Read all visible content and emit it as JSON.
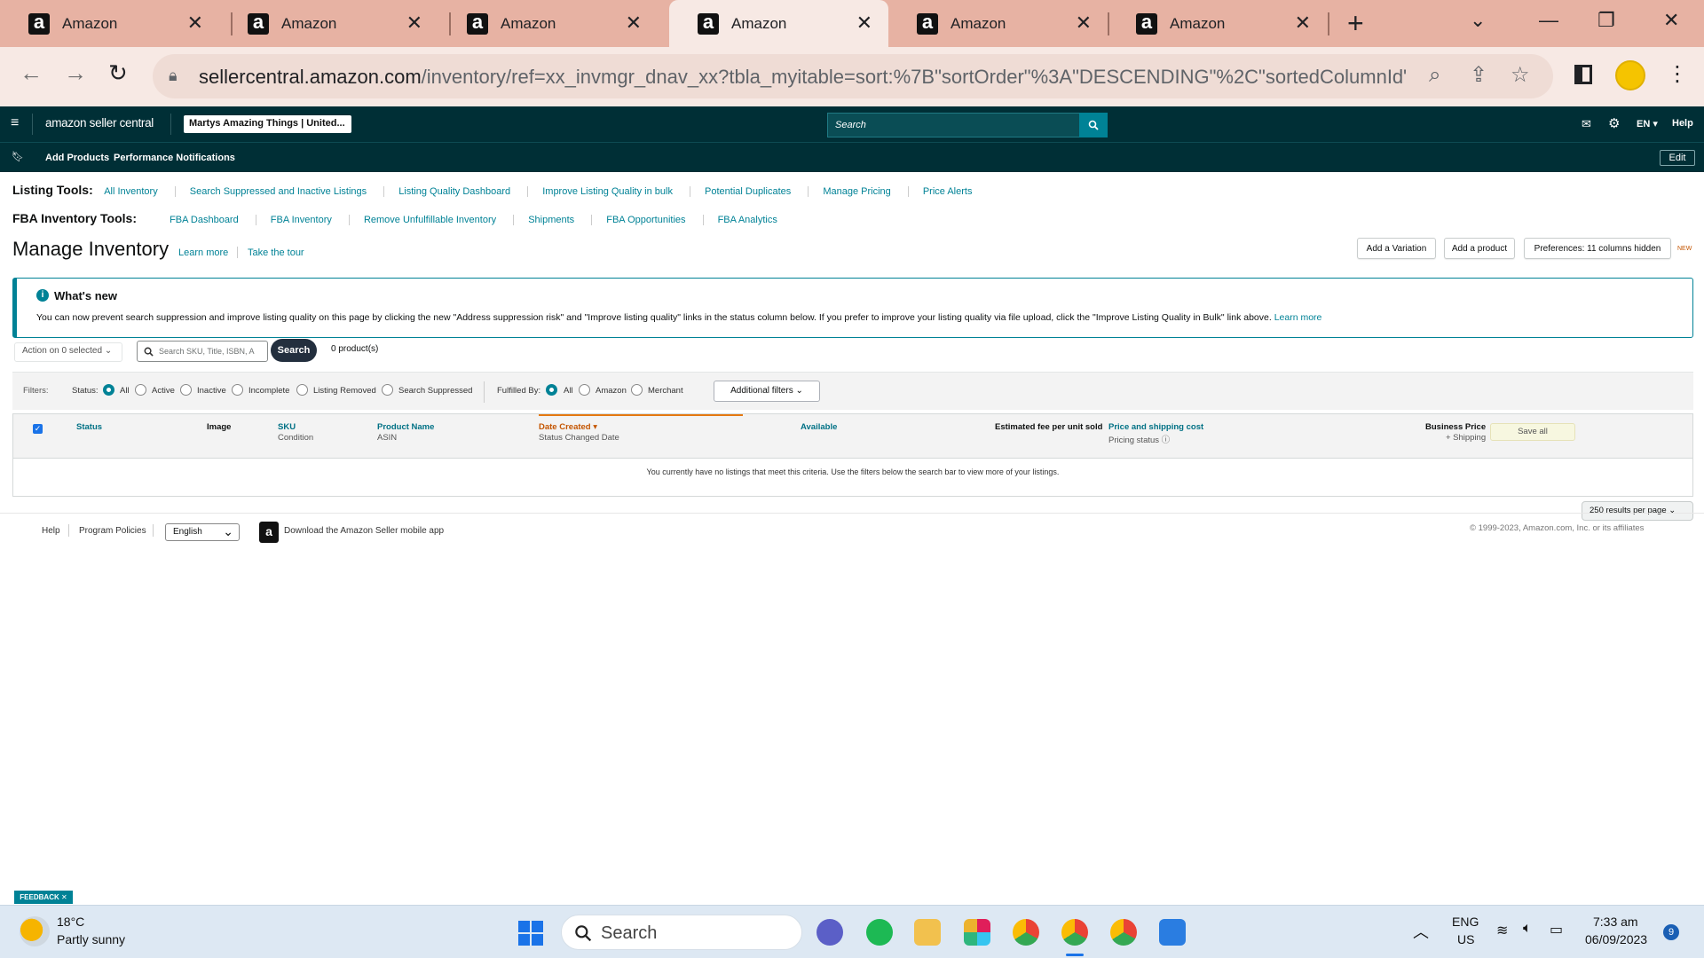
{
  "browser": {
    "tabs": [
      {
        "title": "Amazon"
      },
      {
        "title": "Amazon"
      },
      {
        "title": "Amazon"
      },
      {
        "title": "Amazon",
        "active": true
      },
      {
        "title": "Amazon"
      },
      {
        "title": "Amazon"
      }
    ],
    "url_host": "sellercentral.amazon.com",
    "url_path": "/inventory/ref=xx_invmgr_dnav_xx?tbla_myitable=sort:%7B\"sortOrder\"%3A\"DESCENDING\"%2C\"sortedColumnId\"..."
  },
  "seller_nav": {
    "brand": "amazon seller central",
    "store": "Martys Amazing Things | United...",
    "search_placeholder": "Search",
    "lang": "EN",
    "help": "Help",
    "bookmarks": [
      "Add Products",
      "Performance Notifications"
    ],
    "edit": "Edit"
  },
  "listing_tools": {
    "label": "Listing Tools:",
    "links": [
      "All Inventory",
      "Search Suppressed and Inactive Listings",
      "Listing Quality Dashboard",
      "Improve Listing Quality in bulk",
      "Potential Duplicates",
      "Manage Pricing",
      "Price Alerts"
    ]
  },
  "fba_tools": {
    "label": "FBA Inventory Tools:",
    "links": [
      "FBA Dashboard",
      "FBA Inventory",
      "Remove Unfulfillable Inventory",
      "Shipments",
      "FBA Opportunities",
      "FBA Analytics"
    ]
  },
  "page": {
    "title": "Manage Inventory",
    "learn_more": "Learn more",
    "tour": "Take the tour",
    "add_variation": "Add a Variation",
    "add_product": "Add a product",
    "preferences": "Preferences: 11 columns hidden",
    "new_badge": "NEW"
  },
  "whats_new": {
    "title": "What's new",
    "text": "You can now prevent search suppression and improve listing quality on this page by clicking the new \"Address suppression risk\" and \"Improve listing quality\" links in the status column below. If you prefer to improve your listing quality via file upload, click the \"Improve Listing Quality in Bulk\" link above.",
    "link": "Learn more"
  },
  "actions": {
    "action_dropdown": "Action on 0 selected",
    "search_placeholder": "Search SKU, Title, ISBN, A",
    "search_button": "Search",
    "product_count": "0 product(s)"
  },
  "filters": {
    "label": "Filters:",
    "status_label": "Status:",
    "status_options": [
      "All",
      "Active",
      "Inactive",
      "Incomplete",
      "Listing Removed",
      "Search Suppressed"
    ],
    "fulfilled_label": "Fulfilled By:",
    "fulfilled_options": [
      "All",
      "Amazon",
      "Merchant"
    ],
    "additional": "Additional filters"
  },
  "table": {
    "headers": {
      "status": "Status",
      "image": "Image",
      "sku": "SKU",
      "sku_sub": "Condition",
      "name": "Product Name",
      "name_sub": "ASIN",
      "date": "Date Created",
      "date_sub": "Status Changed Date",
      "available": "Available",
      "fee": "Estimated fee per unit sold",
      "price": "Price and shipping cost",
      "price_sub": "Pricing status",
      "business": "Business Price",
      "business_sub": "+ Shipping"
    },
    "save_all": "Save all",
    "empty": "You currently have no listings that meet this criteria. Use the filters below the search bar to view more of your listings."
  },
  "per_page": "250 results per page",
  "footer": {
    "help": "Help",
    "policies": "Program Policies",
    "language": "English",
    "app": "Download the Amazon Seller mobile app",
    "copyright": "© 1999-2023, Amazon.com, Inc. or its affiliates"
  },
  "feedback": "FEEDBACK",
  "taskbar": {
    "temp": "18°C",
    "weather": "Partly sunny",
    "search": "Search",
    "lang1": "ENG",
    "lang2": "US",
    "time": "7:33 am",
    "date": "06/09/2023",
    "notifications": "9"
  },
  "colors": {
    "teal_nav": "#002f36",
    "link": "#008296",
    "tab_strip": "#e7b2a3"
  }
}
